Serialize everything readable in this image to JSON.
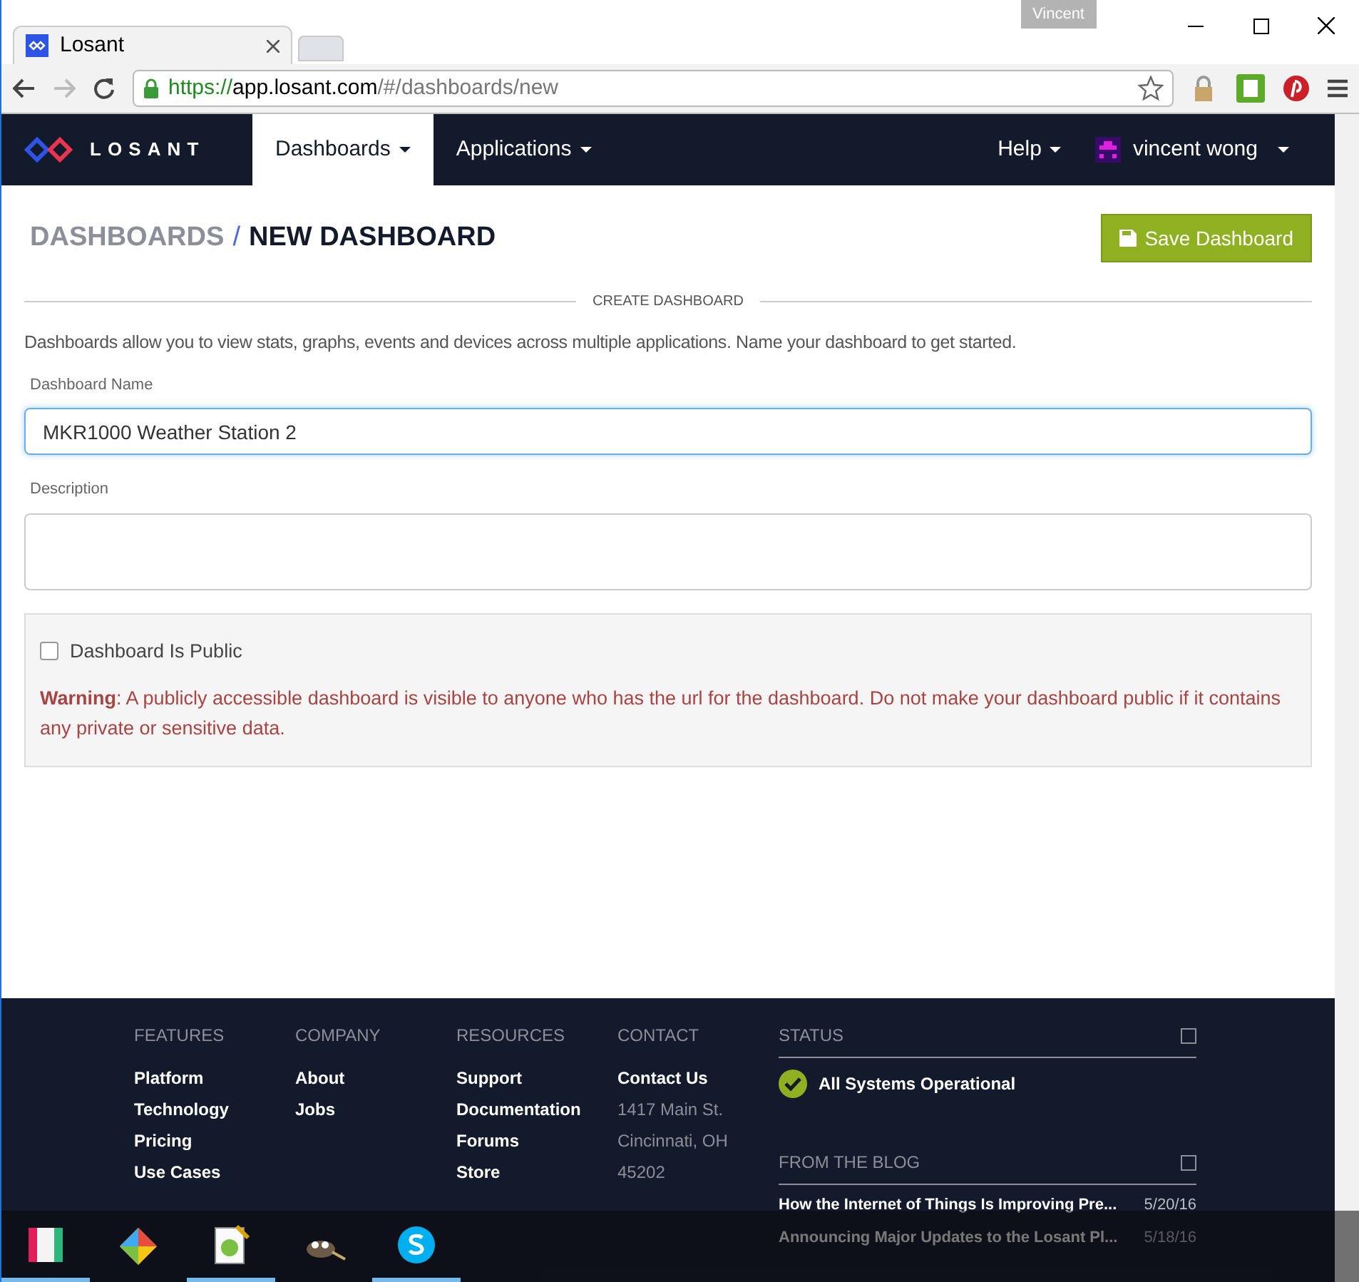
{
  "browser": {
    "profile": "Vincent",
    "tabs": [
      {
        "title": "Losant",
        "selected": true
      }
    ],
    "url": {
      "scheme": "https://",
      "host": "app.losant.com",
      "path": "/#/dashboards/new"
    }
  },
  "navbar": {
    "brand": "LOSANT",
    "menus": [
      {
        "label": "Dashboards",
        "selected": true
      },
      {
        "label": "Applications",
        "selected": false
      }
    ],
    "help": "Help",
    "user": "vincent wong"
  },
  "header": {
    "breadcrumb": "DASHBOARDS",
    "separator": "/",
    "title": "NEW DASHBOARD",
    "save_button": "Save Dashboard"
  },
  "form": {
    "section": "CREATE DASHBOARD",
    "intro": "Dashboards allow you to view stats, graphs, events and devices across multiple applications. Name your dashboard to get started.",
    "name_label": "Dashboard Name",
    "name_value": "MKR1000 Weather Station 2",
    "description_label": "Description",
    "public": {
      "label": "Dashboard Is Public",
      "checked": false
    },
    "warning": "**Warning**: A publicly accessible dashboard is visible to anyone who has the url for the dashboard. Do not make your dashboard public if it contains any private or sensitive data."
  },
  "footer": {
    "columns": [
      {
        "heading": "FEATURES",
        "links": [
          "Platform",
          "Technology",
          "Pricing",
          "Use Cases"
        ]
      },
      {
        "heading": "COMPANY",
        "links": [
          "About",
          "Jobs"
        ]
      },
      {
        "heading": "RESOURCES",
        "links": [
          "Support",
          "Documentation",
          "Forums",
          "Store"
        ]
      },
      {
        "heading": "CONTACT",
        "links": [
          "Contact Us"
        ],
        "address": [
          "1417 Main St.",
          "Cincinnati, OH",
          "45202"
        ]
      }
    ],
    "status": {
      "heading": "STATUS",
      "message": "All Systems Operational"
    },
    "blog": {
      "heading": "FROM THE BLOG",
      "posts": [
        {
          "title": "How the Internet of Things Is Improving Pre...",
          "date": "5/20/16"
        },
        {
          "title": "Announcing Major Updates to the Losant Pl...",
          "date": "5/18/16"
        }
      ]
    }
  },
  "taskbar": [
    {
      "kind": "slack",
      "running": true
    },
    {
      "kind": "git",
      "running": false
    },
    {
      "kind": "notepad",
      "running": true
    },
    {
      "kind": "gimp",
      "running": false
    },
    {
      "kind": "skype",
      "running": true
    }
  ]
}
